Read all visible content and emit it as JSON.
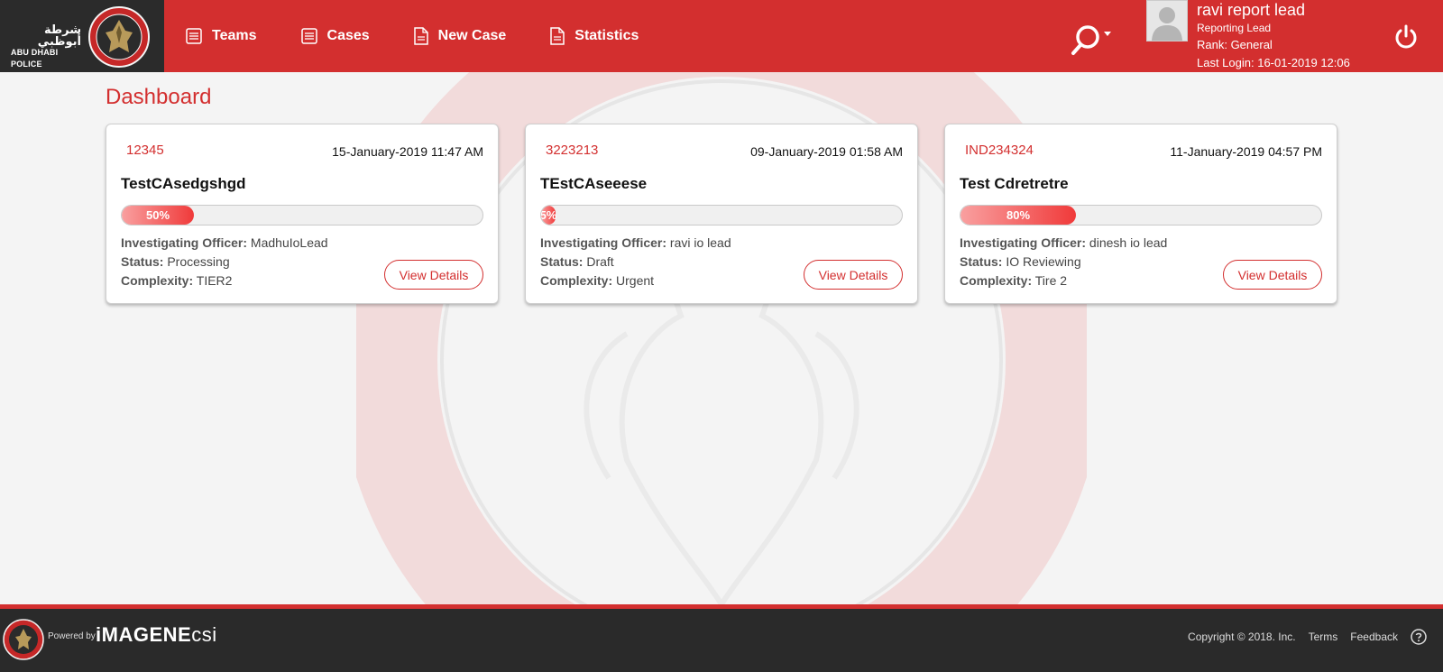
{
  "brand": {
    "logo_arabic": "شرطة أبوظبي",
    "logo_english": "ABU DHABI POLICE"
  },
  "nav": {
    "items": [
      {
        "label": "Teams",
        "icon": "list-icon"
      },
      {
        "label": "Cases",
        "icon": "list-icon"
      },
      {
        "label": "New Case",
        "icon": "document-icon"
      },
      {
        "label": "Statistics",
        "icon": "document-icon"
      }
    ]
  },
  "user": {
    "name": "ravi report lead",
    "role": "Reporting Lead",
    "rank": "Rank: General",
    "last_login": "Last Login: 16-01-2019 12:06"
  },
  "page": {
    "title": "Dashboard"
  },
  "cards": [
    {
      "id": "12345",
      "date": "15-January-2019 11:47 AM",
      "title": "TestCAsedgshgd",
      "progress": 0.5,
      "progress_label": "50%",
      "officer_label": "Investigating Officer:",
      "officer": "MadhuIoLead",
      "status_label": "Status:",
      "status": "Processing",
      "complexity_label": "Complexity:",
      "complexity": "TIER2",
      "button": "View Details"
    },
    {
      "id": "3223213",
      "date": "09-January-2019 01:58 AM",
      "title": "TEstCAseeese",
      "progress": 0.05,
      "progress_label": "5%",
      "officer_label": "Investigating Officer:",
      "officer": "ravi io lead",
      "status_label": "Status:",
      "status": "Draft",
      "complexity_label": "Complexity:",
      "complexity": "Urgent",
      "button": "View Details"
    },
    {
      "id": "IND234324",
      "date": "11-January-2019 04:57 PM",
      "title": "Test Cdretretre",
      "progress": 0.8,
      "progress_label": "80%",
      "officer_label": "Investigating Officer:",
      "officer": "dinesh io lead",
      "status_label": "Status:",
      "status": "IO Reviewing",
      "complexity_label": "Complexity:",
      "complexity": "Tire 2",
      "button": "View Details"
    }
  ],
  "footer": {
    "powered_by": "Powered by",
    "brand_bold": "iMAGENE",
    "brand_light": "csi",
    "copyright": "Copyright © 2018. Inc.",
    "terms": "Terms",
    "feedback": "Feedback"
  },
  "colors": {
    "primary": "#d32f2f",
    "dark": "#2b2b2b"
  }
}
